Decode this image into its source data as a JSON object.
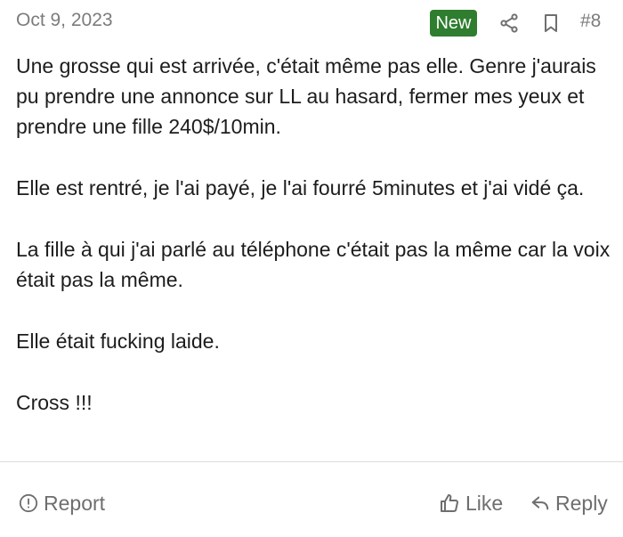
{
  "post": {
    "date": "Oct 9, 2023",
    "badge": "New",
    "number": "#8",
    "paragraphs": [
      "Une grosse qui est arrivée, c'était même pas elle. Genre j'aurais pu prendre une annonce sur LL au hasard, fermer mes yeux et prendre une fille 240$/10min.",
      "Elle est rentré, je l'ai payé, je l'ai fourré 5minutes et j'ai vidé ça.",
      "La fille à qui j'ai parlé au téléphone c'était pas la même car la voix était pas la même.",
      "Elle était fucking laide.",
      "Cross !!!"
    ]
  },
  "actions": {
    "report_label": "Report",
    "like_label": "Like",
    "reply_label": "Reply"
  },
  "icons": {
    "share": "share-icon",
    "bookmark": "bookmark-icon",
    "report": "alert-circle-icon",
    "like": "thumbs-up-icon",
    "reply": "reply-arrow-icon"
  },
  "colors": {
    "badge_bg": "#2f7d2f",
    "badge_text": "#ffffff",
    "muted_text": "#7c7c7c",
    "body_text": "#1d1d1d",
    "divider": "#dcdcdc"
  }
}
